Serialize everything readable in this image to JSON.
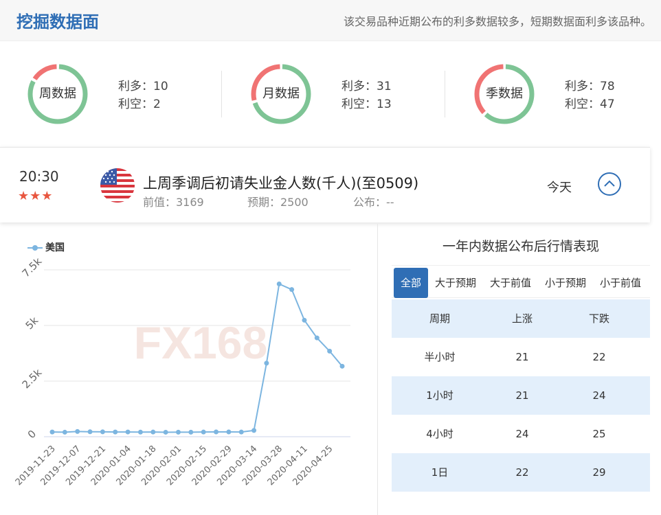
{
  "header": {
    "title": "挖掘数据面",
    "subtitle": "该交易品种近期公布的利多数据较多，短期数据面利多该品种。"
  },
  "stats": [
    {
      "label": "周数据",
      "bull_text": "利多：10",
      "bear_text": "利空：2",
      "bull": 10,
      "bear": 2
    },
    {
      "label": "月数据",
      "bull_text": "利多：31",
      "bear_text": "利空：13",
      "bull": 31,
      "bear": 13
    },
    {
      "label": "季数据",
      "bull_text": "利多：78",
      "bear_text": "利空：47",
      "bull": 78,
      "bear": 47
    }
  ],
  "colors": {
    "bull": "#7ec495",
    "bear": "#f07373",
    "accent": "#2f6eb5",
    "line": "#7cb5e0"
  },
  "event": {
    "time": "20:30",
    "stars": "★★★",
    "country_flag": "us-flag-icon",
    "title": "上周季调后初请失业金人数(千人)(至0509)",
    "prev": "前值：3169",
    "forecast": "预期：2500",
    "actual": "公布：--",
    "day": "今天"
  },
  "chart_data": {
    "type": "line",
    "legend": "美国",
    "watermark": "FX168",
    "x": [
      "2019-11-23",
      "2019-11-30",
      "2019-12-07",
      "2019-12-14",
      "2019-12-21",
      "2019-12-28",
      "2020-01-04",
      "2020-01-11",
      "2020-01-18",
      "2020-01-25",
      "2020-02-01",
      "2020-02-08",
      "2020-02-15",
      "2020-02-22",
      "2020-02-29",
      "2020-03-07",
      "2020-03-14",
      "2020-03-21",
      "2020-03-28",
      "2020-04-04",
      "2020-04-11",
      "2020-04-18",
      "2020-04-25",
      "2020-05-02"
    ],
    "x_tick_labels": [
      "2019-11-23",
      "2019-12-07",
      "2019-12-21",
      "2020-01-04",
      "2020-01-18",
      "2020-02-01",
      "2020-02-15",
      "2020-02-29",
      "2020-03-14",
      "2020-03-28",
      "2020-04-11",
      "2020-04-25"
    ],
    "series": [
      {
        "name": "美国",
        "values": [
          213,
          203,
          235,
          222,
          220,
          212,
          214,
          207,
          211,
          202,
          204,
          203,
          211,
          216,
          217,
          211,
          282,
          3307,
          6867,
          6615,
          5237,
          4442,
          3846,
          3169
        ]
      }
    ],
    "y_ticks": [
      "0",
      "2.5k",
      "5k",
      "7.5k"
    ],
    "ylim": [
      0,
      7500
    ]
  },
  "perf": {
    "title": "一年内数据公布后行情表现",
    "tabs": [
      "全部",
      "大于预期",
      "大于前值",
      "小于预期",
      "小于前值"
    ],
    "columns": [
      "周期",
      "上涨",
      "下跌"
    ],
    "rows": [
      [
        "半小时",
        "21",
        "22"
      ],
      [
        "1小时",
        "21",
        "24"
      ],
      [
        "4小时",
        "24",
        "25"
      ],
      [
        "1日",
        "22",
        "29"
      ]
    ]
  }
}
